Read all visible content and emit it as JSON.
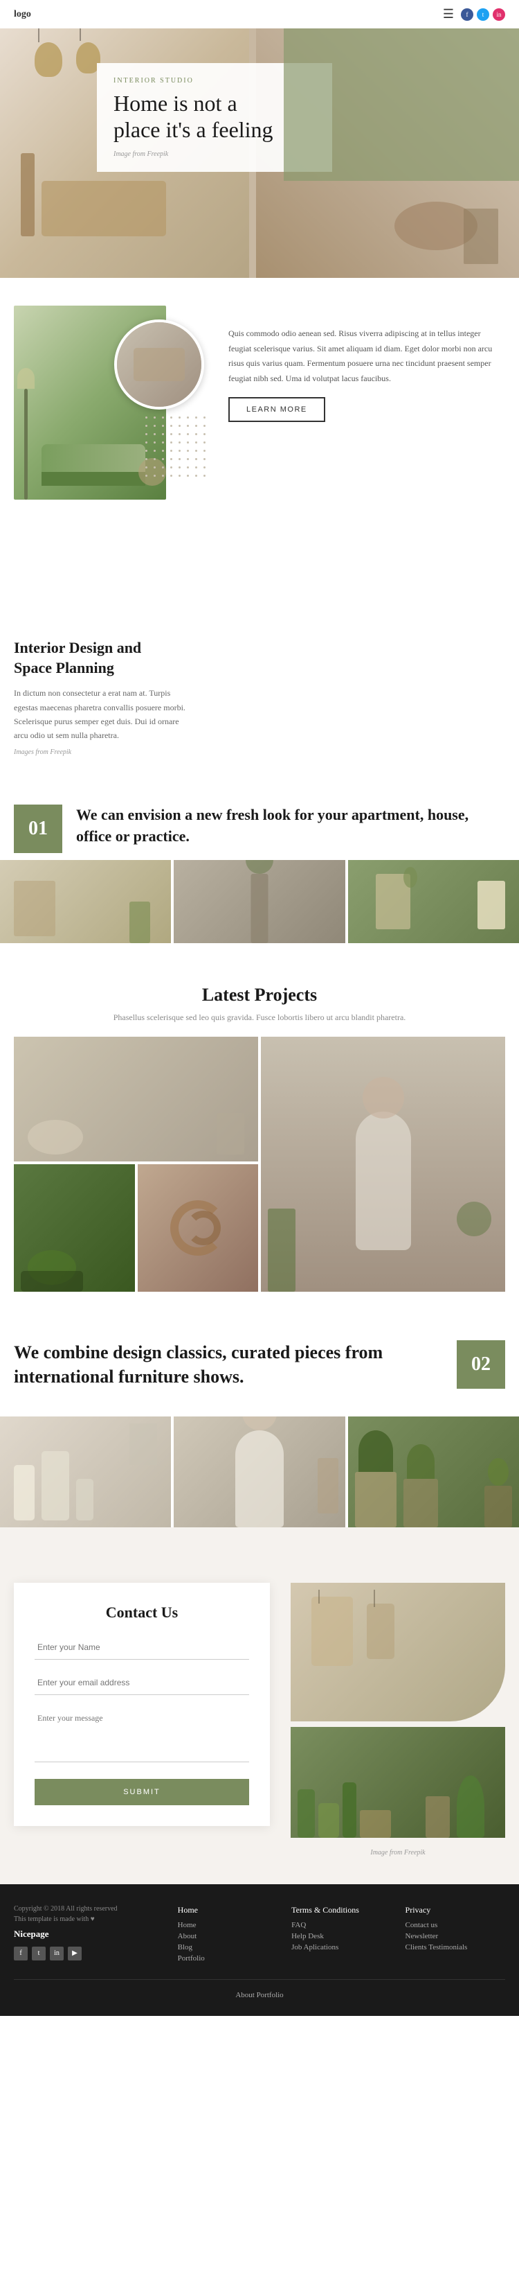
{
  "header": {
    "logo": "logo",
    "nav_icon": "☰",
    "social": [
      {
        "name": "facebook",
        "icon": "f",
        "color": "#3b5998"
      },
      {
        "name": "twitter",
        "icon": "t",
        "color": "#1da1f2"
      },
      {
        "name": "instagram",
        "icon": "in",
        "color": "#e1306c"
      }
    ]
  },
  "hero": {
    "tag": "INTERIOR STUDIO",
    "title": "Home is not a\nplace it's a feeling",
    "image_credit": "Image from Freepik"
  },
  "section_interior": {
    "title": "Interior Design and\nSpace Planning",
    "body1": "In dictum non consectetur a erat nam at. Turpis egestas maecenas pharetra convallis posuere morbi. Scelerisque purus semper eget duis. Dui id ornare arcu odio ut sem nulla pharetra.",
    "image_credit": "Images from Freepik",
    "side_text": "Quis commodo odio aenean sed. Risus viverra adipiscing at in tellus integer feugiat scelerisque varius. Sit amet aliquam id diam. Eget dolor morbi non arcu risus quis varius quam. Fermentum posuere urna nec tincidunt praesent semper feugiat nibh sed. Uma id volutpat lacus faucibus.",
    "cta": "LEARN MORE"
  },
  "section_envision": {
    "number": "01",
    "text": "We can envision a new fresh look for your apartment, house, office or practice."
  },
  "section_projects": {
    "heading": "Latest Projects",
    "subtext": "Phasellus scelerisque sed leo quis gravida. Fusce lobortis libero ut arcu blandit pharetra."
  },
  "section_combine": {
    "title": "We combine design classics, curated pieces from international furniture shows.",
    "number": "02"
  },
  "contact": {
    "title": "Contact Us",
    "name_placeholder": "Enter your Name",
    "email_placeholder": "Enter your email address",
    "message_placeholder": "Enter your message",
    "submit_label": "SUBMIT",
    "image_credit": "Image from Freepik"
  },
  "footer": {
    "columns": [
      {
        "title": "",
        "copyright": "Copyright © 2018 All rights reserved",
        "tagline": "This template is made with ♥",
        "brand": "Nicepage",
        "links": []
      },
      {
        "title": "Home",
        "links": [
          "Home",
          "About",
          "Blog",
          "Portfolio"
        ]
      },
      {
        "title": "Terms & Conditions",
        "links": [
          "Terms & Conditions",
          "FAQ",
          "Help Desk",
          "Job Aplications"
        ]
      },
      {
        "title": "Privacy",
        "links": [
          "Privacy",
          "Contact us",
          "Newsletter",
          "Clients Testimonials"
        ]
      }
    ],
    "social_icons": [
      "f",
      "t",
      "in",
      "yt"
    ],
    "about_portfolio": "About Portfolio"
  }
}
